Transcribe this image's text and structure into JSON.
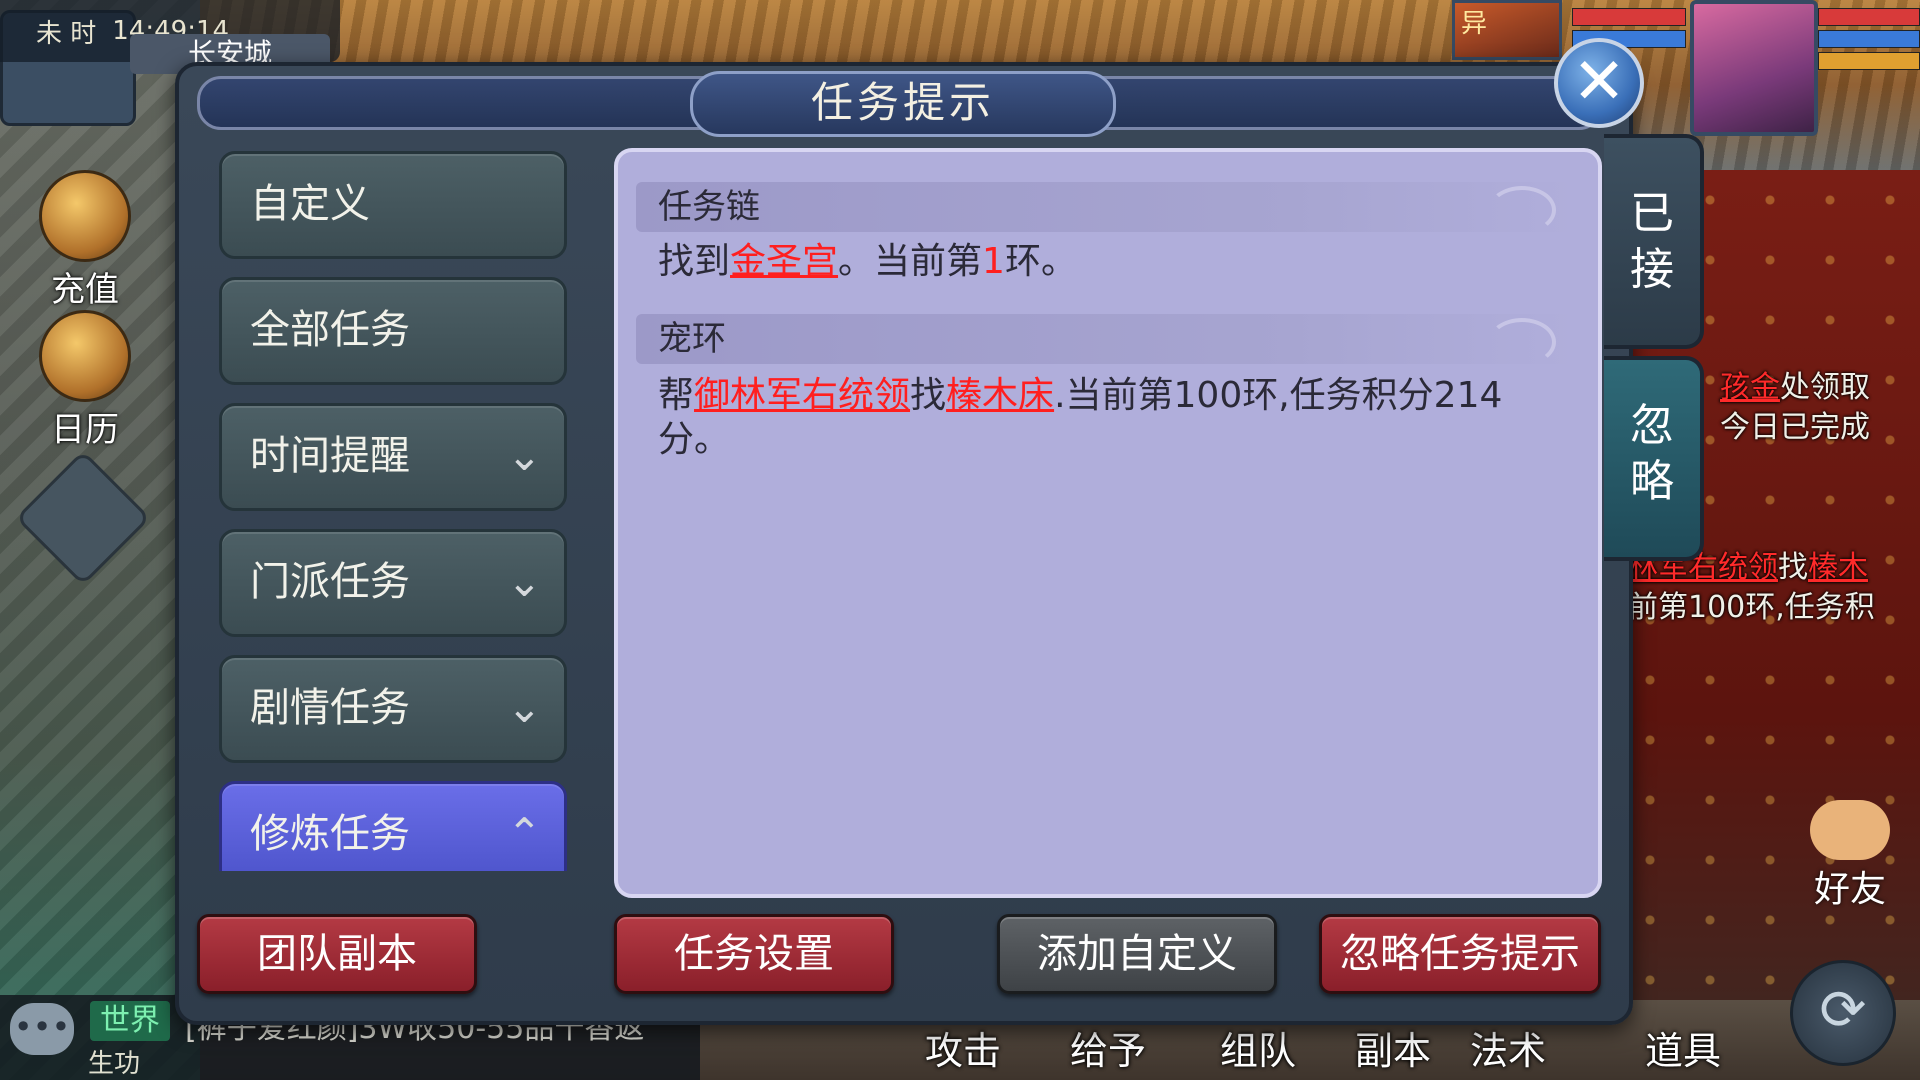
{
  "hud": {
    "time_label": "未 时",
    "clock": "14:49:14",
    "city": "长安城",
    "recharge": "充值",
    "calendar": "日历",
    "pet_tag": "异"
  },
  "dialog": {
    "title": "任务提示",
    "categories": [
      {
        "label": "自定义",
        "chevron": ""
      },
      {
        "label": "全部任务",
        "chevron": ""
      },
      {
        "label": "时间提醒",
        "chevron": "⌄"
      },
      {
        "label": "门派任务",
        "chevron": "⌄"
      },
      {
        "label": "剧情任务",
        "chevron": "⌄"
      },
      {
        "label": "修炼任务",
        "chevron": "⌃"
      }
    ],
    "sections": [
      {
        "header": "任务链",
        "t1": "找到",
        "link1": "金圣宫",
        "t2": "。当前第",
        "num": "1",
        "t3": "环。"
      },
      {
        "header": "宠环",
        "t1": "帮",
        "link1": "御林军右统领",
        "t2": "找",
        "link2": "榛木床",
        "t3": ".当前第100环,任务积分214分。"
      }
    ],
    "side_tabs": {
      "accepted": "已接",
      "ignore": "忽略"
    },
    "buttons": {
      "team_dungeon": "团队副本",
      "task_settings": "任务设置",
      "add_custom": "添加自定义",
      "ignore_hint": "忽略任务提示"
    }
  },
  "right_hints": {
    "line1_link": "孩金",
    "line1_text": "处领取",
    "line2": "今日已完成",
    "line3_link1": "林军右统领",
    "line3_text": "找",
    "line3_link2": "榛木",
    "line4": "前第100环,任务积"
  },
  "chat": {
    "channel": "世界",
    "message": "[裤子爱红颜]3W收50-55品十香返",
    "sub": "生功"
  },
  "bottom_menu": [
    "攻击",
    "给予",
    "组队",
    "副本",
    "法术",
    "道具"
  ],
  "friends": "好友",
  "colors": {
    "accent_red": "#ff1f1f",
    "panel": "#b0aedb",
    "active_tab": "#5a60d8",
    "button_red": "#9c2a35"
  }
}
